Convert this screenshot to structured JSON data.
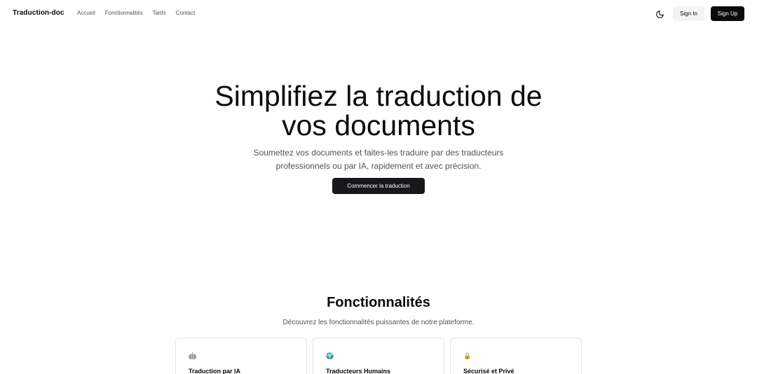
{
  "header": {
    "brand": "Traduction-doc",
    "nav": [
      "Accueil",
      "Fonctionnalités",
      "Tarifs",
      "Contact"
    ],
    "theme_toggle_icon": "moon-icon",
    "signin_label": "Sign In",
    "signup_label": "Sign Up"
  },
  "hero": {
    "title_line1": "Simplifiez la traduction de",
    "title_line2": "vos documents",
    "subtitle_line1": "Soumettez vos documents et faites-les traduire par des traducteurs",
    "subtitle_line2": "professionnels ou par IA, rapidement et avec précision.",
    "cta_label": "Commencer la traduction"
  },
  "features": {
    "title": "Fonctionnalités",
    "subtitle": "Découvrez les fonctionnalités puissantes de notre plateforme.",
    "cards": [
      {
        "icon": "🤖",
        "icon_name": "robot-icon",
        "title": "Traduction par IA"
      },
      {
        "icon": "🌍",
        "icon_name": "globe-icon",
        "title": "Traducteurs Humains"
      },
      {
        "icon": "🔒",
        "icon_name": "lock-icon",
        "title": "Sécurisé et Privé"
      }
    ]
  },
  "colors": {
    "primary": "#18181b",
    "muted_text": "#52525b",
    "secondary_bg": "#f4f4f5",
    "border": "#e4e4e7"
  }
}
